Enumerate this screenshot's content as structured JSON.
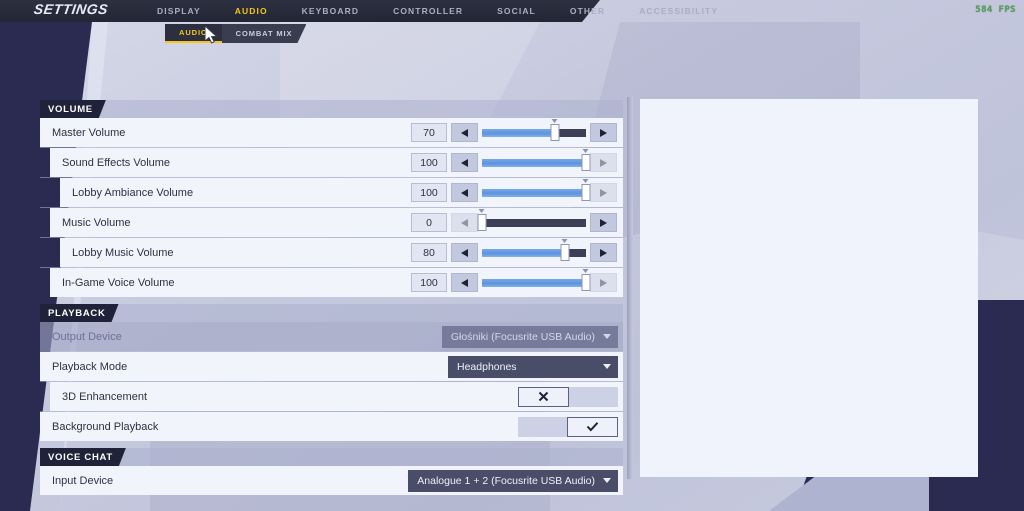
{
  "header": {
    "logo": "SETTINGS",
    "nav": [
      {
        "label": "DISPLAY",
        "active": false
      },
      {
        "label": "AUDIO",
        "active": true
      },
      {
        "label": "KEYBOARD",
        "active": false
      },
      {
        "label": "CONTROLLER",
        "active": false
      },
      {
        "label": "SOCIAL",
        "active": false
      },
      {
        "label": "OTHER",
        "active": false
      },
      {
        "label": "ACCESSIBILITY",
        "active": false
      }
    ],
    "subtabs": [
      {
        "label": "AUDIO",
        "active": true
      },
      {
        "label": "COMBAT MIX",
        "active": false
      }
    ]
  },
  "sections": [
    {
      "title": "VOLUME",
      "rows": [
        {
          "label": "Master Volume",
          "type": "slider",
          "value": "70",
          "percent": 70,
          "indent": 0,
          "disabled": false,
          "left_arrow_enabled": true,
          "right_arrow_enabled": true
        },
        {
          "label": "Sound Effects Volume",
          "type": "slider",
          "value": "100",
          "percent": 100,
          "indent": 1,
          "disabled": false,
          "left_arrow_enabled": true,
          "right_arrow_enabled": false
        },
        {
          "label": "Lobby Ambiance Volume",
          "type": "slider",
          "value": "100",
          "percent": 100,
          "indent": 2,
          "disabled": false,
          "left_arrow_enabled": true,
          "right_arrow_enabled": false
        },
        {
          "label": "Music Volume",
          "type": "slider",
          "value": "0",
          "percent": 0,
          "indent": 1,
          "disabled": false,
          "left_arrow_enabled": false,
          "right_arrow_enabled": true
        },
        {
          "label": "Lobby Music Volume",
          "type": "slider",
          "value": "80",
          "percent": 80,
          "indent": 2,
          "disabled": false,
          "left_arrow_enabled": true,
          "right_arrow_enabled": true
        },
        {
          "label": "In-Game Voice Volume",
          "type": "slider",
          "value": "100",
          "percent": 100,
          "indent": 1,
          "disabled": false,
          "left_arrow_enabled": true,
          "right_arrow_enabled": false
        }
      ]
    },
    {
      "title": "PLAYBACK",
      "rows": [
        {
          "label": "Output Device",
          "type": "dropdown",
          "value": "Głośniki (Focusrite USB Audio)",
          "indent": 0,
          "disabled": true
        },
        {
          "label": "Playback Mode",
          "type": "dropdown",
          "value": "Headphones",
          "indent": 0,
          "disabled": false
        },
        {
          "label": "3D Enhancement",
          "type": "toggle",
          "state": "off",
          "indent": 1,
          "disabled": false
        },
        {
          "label": "Background Playback",
          "type": "toggle",
          "state": "on",
          "indent": 0,
          "disabled": false
        }
      ]
    },
    {
      "title": "VOICE CHAT",
      "rows": [
        {
          "label": "Input Device",
          "type": "dropdown",
          "value": "Analogue 1 + 2 (Focusrite USB Audio)",
          "indent": 0,
          "disabled": false
        }
      ]
    }
  ],
  "overlay": {
    "fps": "584 FPS"
  }
}
